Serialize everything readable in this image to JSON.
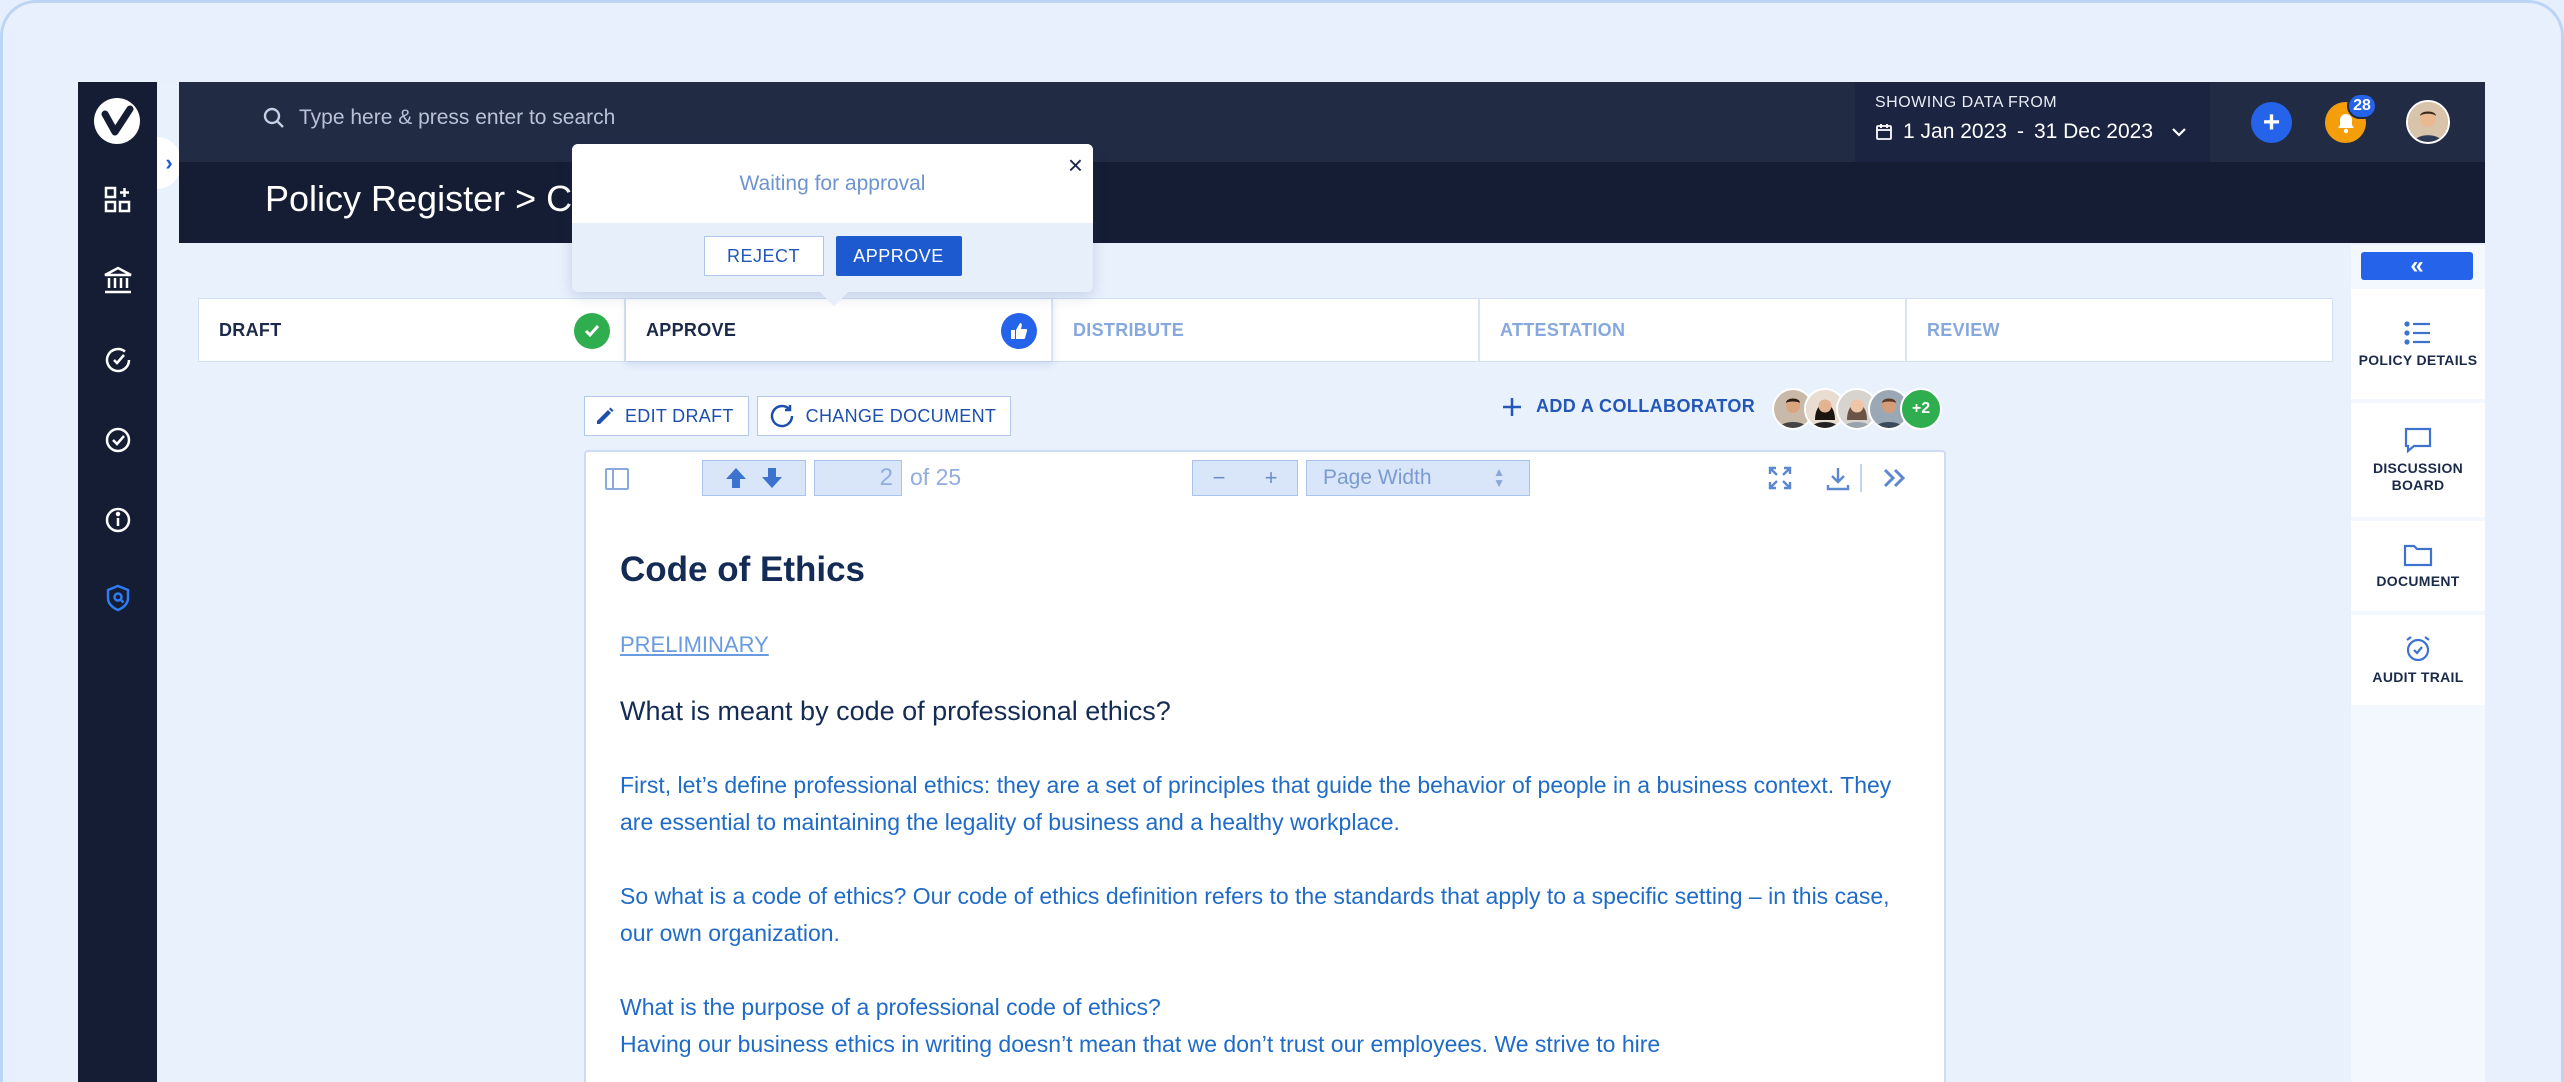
{
  "search": {
    "placeholder": "Type here & press enter to search"
  },
  "date_range": {
    "label": "SHOWING DATA FROM",
    "start": "1 Jan 2023",
    "separator": "-",
    "end": "31 Dec 2023"
  },
  "notifications": {
    "count": "28"
  },
  "page": {
    "title": "Policy Register > Code of Ethics Draft"
  },
  "approval_popup": {
    "message": "Waiting for approval",
    "reject_label": "REJECT",
    "approve_label": "APPROVE"
  },
  "steps": [
    {
      "label": "DRAFT",
      "status": "done"
    },
    {
      "label": "APPROVE",
      "status": "active"
    },
    {
      "label": "DISTRIBUTE",
      "status": "pending"
    },
    {
      "label": "ATTESTATION",
      "status": "pending"
    },
    {
      "label": "REVIEW",
      "status": "pending"
    }
  ],
  "actions": {
    "edit_draft": "EDIT DRAFT",
    "change_document": "CHANGE DOCUMENT",
    "add_collaborator": "ADD A COLLABORATOR",
    "more_collaborators": "+2"
  },
  "viewer": {
    "current_page": "2",
    "total_pages": "of 25",
    "zoom_minus": "−",
    "zoom_plus": "+",
    "zoom_mode": "Page Width"
  },
  "document": {
    "title": "Code of Ethics",
    "tag": "PRELIMINARY",
    "heading": "What is meant by code of professional ethics?",
    "p1": "First, let’s define professional ethics: they are a set of principles that guide the behavior of people in a business context. They are essential to maintaining the legality of business and a healthy workplace.",
    "p2": "So what is a code of ethics? Our code of ethics definition refers to the standards that apply to a specific setting – in this case, our own organization.",
    "p3_line1": "What is the purpose of a professional code of ethics?",
    "p3_line2": "Having our business ethics in writing doesn’t mean that we don’t trust our employees. We strive to hire"
  },
  "right_panel": [
    {
      "label": "POLICY DETAILS",
      "icon": "list-icon"
    },
    {
      "label": "DISCUSSION BOARD",
      "icon": "chat-icon"
    },
    {
      "label": "DOCUMENT",
      "icon": "folder-icon"
    },
    {
      "label": "AUDIT TRAIL",
      "icon": "alarm-clock-icon"
    }
  ],
  "colors": {
    "navy": "#141d33",
    "primary": "#2563eb",
    "success": "#2fae4f",
    "warning": "#f59e0b"
  }
}
